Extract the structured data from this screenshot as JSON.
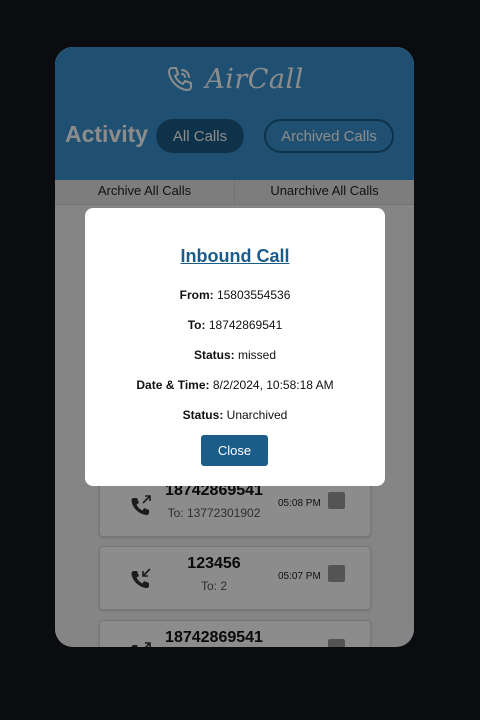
{
  "header": {
    "brand": "AirCall",
    "activity_label": "Activity",
    "tabs": [
      "All Calls",
      "Archived Calls"
    ]
  },
  "actions": [
    "Archive All Calls",
    "Unarchive All Calls"
  ],
  "calls": [
    {
      "number": "18742869541",
      "to": "To: 13772301902",
      "time": "05:08 PM",
      "icon": "outgoing-call-icon"
    },
    {
      "number": "123456",
      "to": "To: 2",
      "time": "05:07 PM",
      "icon": "incoming-call-icon"
    },
    {
      "number": "18742869541",
      "to": "",
      "time": "",
      "icon": "outgoing-call-icon"
    }
  ],
  "modal": {
    "title": "Inbound Call",
    "from_label": "From:",
    "from_value": "15803554536",
    "to_label": "To:",
    "to_value": "18742869541",
    "status_label": "Status:",
    "status_value": "missed",
    "datetime_label": "Date & Time:",
    "datetime_value": "8/2/2024, 10:58:18 AM",
    "archive_label": "Status:",
    "archive_value": "Unarchived",
    "close_label": "Close"
  },
  "colors": {
    "header_bg": "#3a93cf",
    "accent": "#1b5c88",
    "page_bg": "#0b0c10"
  }
}
